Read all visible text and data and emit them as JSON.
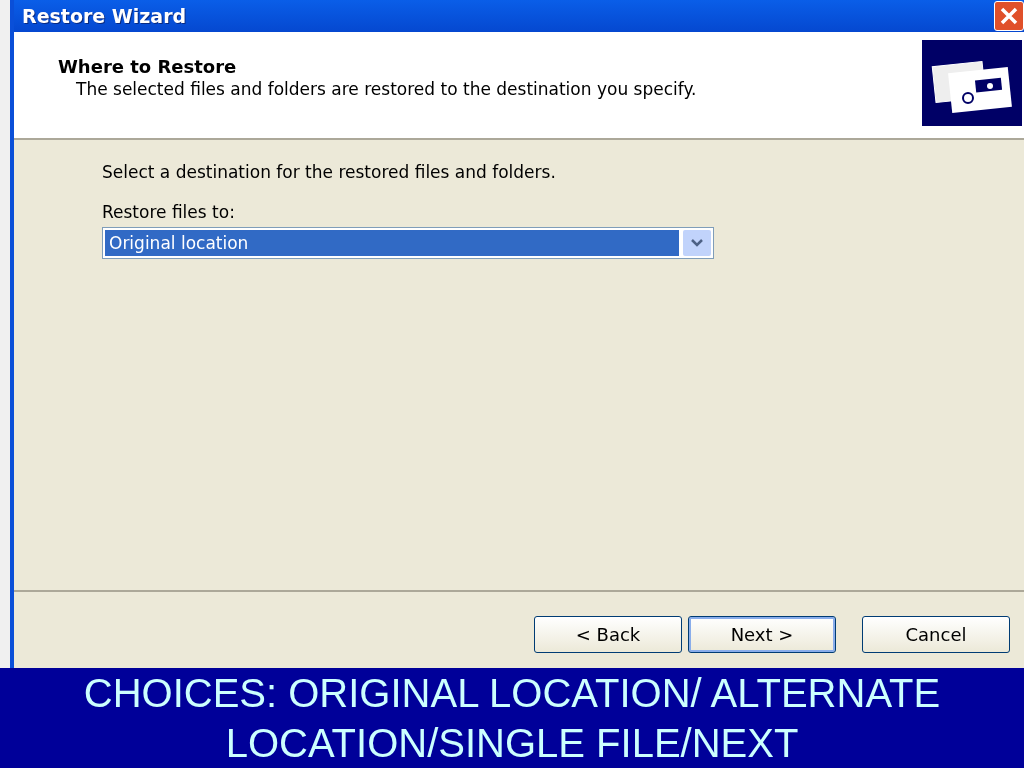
{
  "window": {
    "title": "Restore Wizard"
  },
  "header": {
    "title": "Where to Restore",
    "subtitle": "The selected files and folders are restored to the destination you specify."
  },
  "body": {
    "instruction": "Select a destination for the restored files and folders.",
    "field_label": "Restore files to:",
    "dropdown": {
      "value": "Original location"
    }
  },
  "buttons": [
    {
      "label": "< Back",
      "default": false
    },
    {
      "label": "Next >",
      "default": true
    },
    {
      "label": "Cancel",
      "default": false
    }
  ],
  "caption": "CHOICES: ORIGINAL LOCATION/ ALTERNATE LOCATION/SINGLE FILE/NEXT"
}
